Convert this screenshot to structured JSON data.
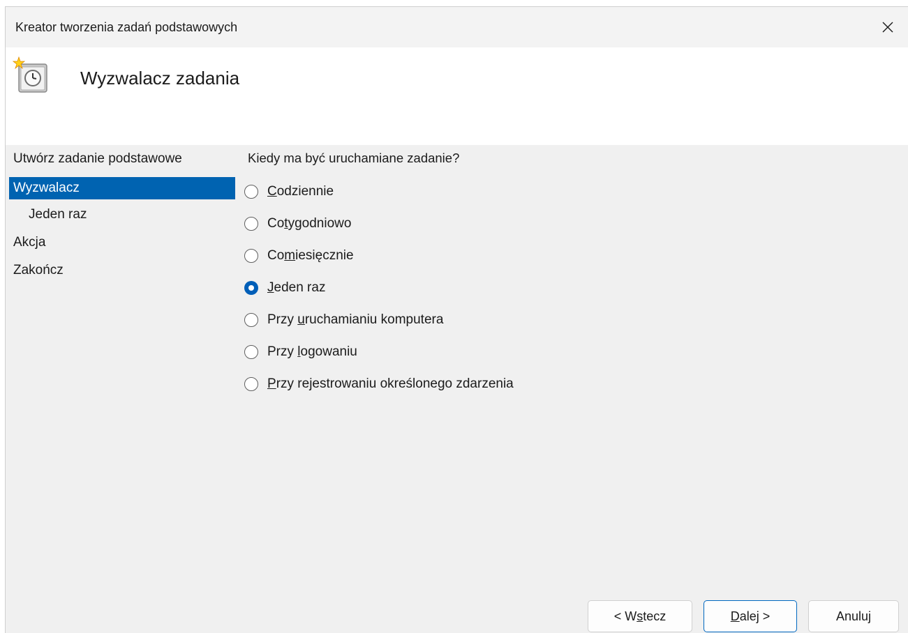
{
  "window": {
    "title": "Kreator tworzenia zadań podstawowych",
    "close_icon": "close-icon"
  },
  "header": {
    "icon": "task-scheduler-icon",
    "title": "Wyzwalacz zadania"
  },
  "sidebar": {
    "items": [
      {
        "label": "Utwórz zadanie podstawowe",
        "selected": false,
        "sub": false
      },
      {
        "label": "Wyzwalacz",
        "selected": true,
        "sub": false
      },
      {
        "label": "Jeden raz",
        "selected": false,
        "sub": true
      },
      {
        "label": "Akcja",
        "selected": false,
        "sub": false
      },
      {
        "label": "Zakończ",
        "selected": false,
        "sub": false
      }
    ]
  },
  "main": {
    "question": "Kiedy ma być uruchamiane zadanie?",
    "options": [
      {
        "pre": "",
        "u": "C",
        "post": "odziennie",
        "checked": false
      },
      {
        "pre": "Co",
        "u": "t",
        "post": "ygodniowo",
        "checked": false
      },
      {
        "pre": "Co",
        "u": "m",
        "post": "iesięcznie",
        "checked": false
      },
      {
        "pre": "",
        "u": "J",
        "post": "eden raz",
        "checked": true
      },
      {
        "pre": "Przy ",
        "u": "u",
        "post": "ruchamianiu komputera",
        "checked": false
      },
      {
        "pre": "Przy ",
        "u": "l",
        "post": "ogowaniu",
        "checked": false
      },
      {
        "pre": "",
        "u": "P",
        "post": "rzy rejestrowaniu określonego zdarzenia",
        "checked": false
      }
    ]
  },
  "buttons": {
    "back": {
      "pre": "< W",
      "u": "s",
      "post": "tecz"
    },
    "next": {
      "pre": "",
      "u": "D",
      "post": "alej >"
    },
    "cancel": {
      "label": "Anuluj"
    }
  },
  "colors": {
    "accent": "#0063b1",
    "radio_checked": "#005fb8",
    "dialog_bg": "#f0f0f0",
    "header_bg": "#ffffff"
  }
}
